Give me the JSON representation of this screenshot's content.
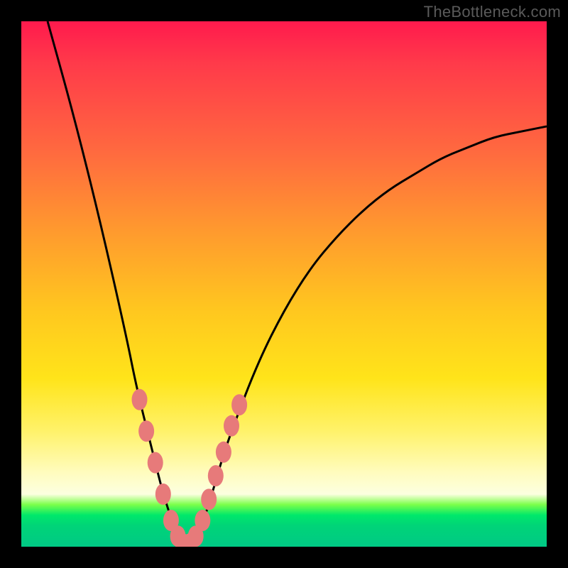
{
  "watermark": "TheBottleneck.com",
  "chart_data": {
    "type": "line",
    "title": "",
    "xlabel": "",
    "ylabel": "",
    "xlim": [
      0,
      100
    ],
    "ylim": [
      0,
      100
    ],
    "series": [
      {
        "name": "bottleneck-curve",
        "x": [
          5,
          10,
          15,
          20,
          22,
          25,
          27,
          29,
          30,
          31,
          32,
          33,
          34,
          36,
          38,
          40,
          45,
          50,
          55,
          60,
          65,
          70,
          75,
          80,
          85,
          90,
          95,
          100
        ],
        "values": [
          100,
          82,
          62,
          40,
          30,
          18,
          10,
          4,
          1,
          0,
          0,
          1,
          3,
          9,
          16,
          22,
          35,
          45,
          53,
          59,
          64,
          68,
          71,
          74,
          76,
          78,
          79,
          80
        ]
      }
    ],
    "markers": {
      "name": "highlight-dots",
      "x": [
        22.5,
        23.8,
        25.5,
        27.0,
        28.5,
        29.8,
        30.8,
        32.0,
        33.2,
        34.5,
        35.7,
        37.0,
        38.5,
        40.0,
        41.5
      ],
      "values": [
        28.0,
        22.0,
        16.0,
        10.0,
        5.0,
        2.0,
        0.5,
        0.5,
        2.0,
        5.0,
        9.0,
        13.5,
        18.0,
        23.0,
        27.0
      ]
    },
    "gradient_stops": [
      {
        "pos": 0,
        "color": "#ff1a4d"
      },
      {
        "pos": 25,
        "color": "#ff6a3f"
      },
      {
        "pos": 55,
        "color": "#ffc71f"
      },
      {
        "pos": 86,
        "color": "#fffcbf"
      },
      {
        "pos": 93,
        "color": "#00e86a"
      },
      {
        "pos": 100,
        "color": "#00c985"
      }
    ]
  }
}
